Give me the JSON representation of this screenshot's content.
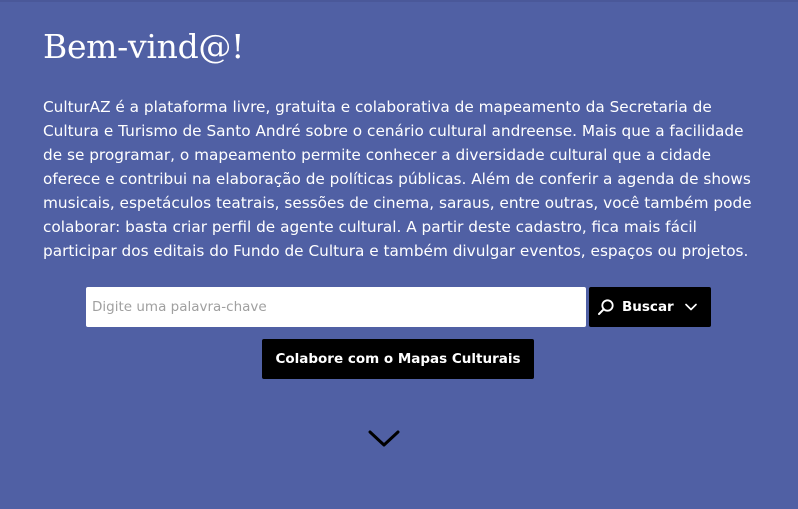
{
  "welcome": {
    "title": "Bem-vind@!",
    "description": "CulturAZ é a plataforma livre, gratuita e colaborativa de mapeamento da Secretaria de Cultura e Turismo de Santo André sobre o cenário cultural andreense. Mais que a facilidade de se programar, o mapeamento permite conhecer a diversidade cultural que a cidade oferece e contribui na elaboração de políticas públicas. Além de conferir a agenda de shows musicais, espetáculos teatrais, sessões de cinema, saraus, entre outras, você também pode colaborar: basta criar perfil de agente cultural. A partir deste cadastro, fica mais fácil participar dos editais do Fundo de Cultura e também divulgar eventos, espaços ou projetos."
  },
  "search": {
    "placeholder": "Digite uma palavra-chave",
    "value": "",
    "button_label": "Buscar"
  },
  "cta": {
    "label": "Colabore com o Mapas Culturais"
  },
  "icons": {
    "search": "search-icon",
    "dropdown": "chevron-down-icon",
    "scroll": "chevron-down-icon"
  },
  "colors": {
    "background": "#5060a4",
    "button": "#000000",
    "text": "#ffffff"
  }
}
